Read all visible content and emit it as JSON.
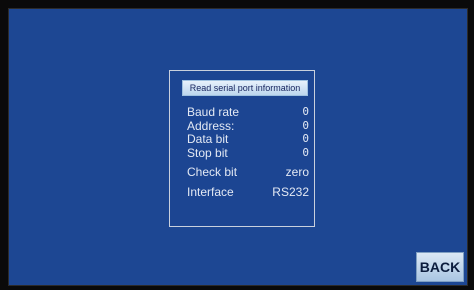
{
  "title": "Read serial port information",
  "rows": [
    {
      "label": "Baud rate",
      "value": "0"
    },
    {
      "label": "Address:",
      "value": "0"
    },
    {
      "label": "Data bit",
      "value": "0"
    },
    {
      "label": "Stop bit",
      "value": "0"
    },
    {
      "label": "Check bit",
      "value": "zero"
    },
    {
      "label": "Interface",
      "value": "RS232"
    }
  ],
  "back_label": "BACK",
  "colors": {
    "background": "#1d4793",
    "title_bar": "#d2e4f5",
    "button": "#c3d8ed"
  }
}
